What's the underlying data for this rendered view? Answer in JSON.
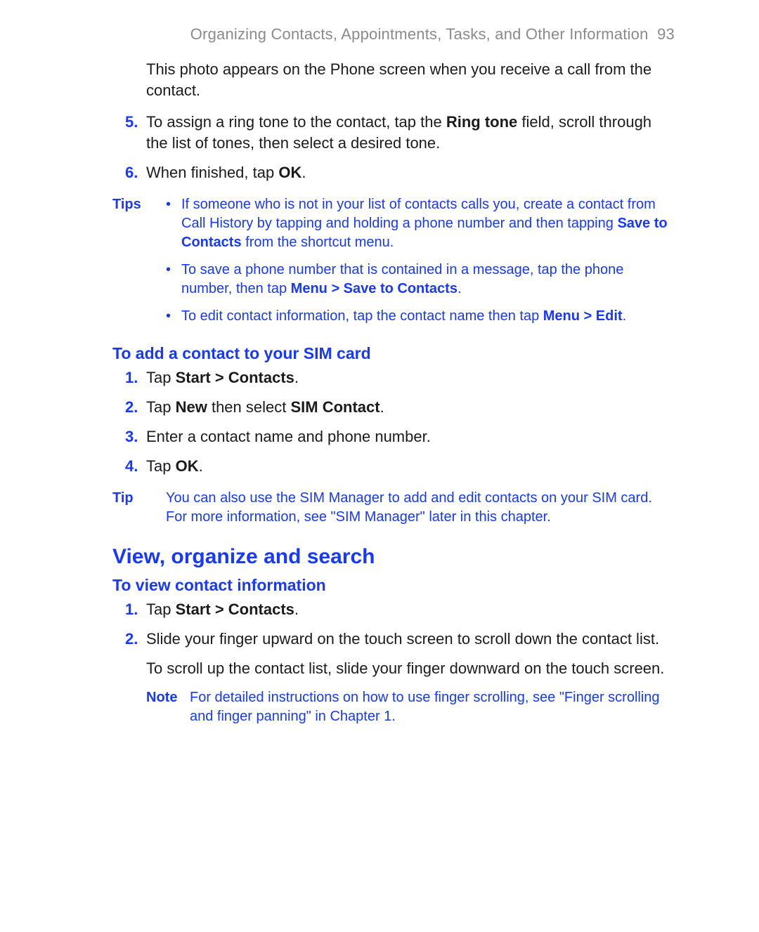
{
  "header": {
    "title": "Organizing Contacts, Appointments, Tasks, and Other Information",
    "page_number": "93"
  },
  "intro_para": "This photo appears on the Phone screen when you receive a call from the contact.",
  "steps_top": [
    {
      "num": "5.",
      "pre": "To assign a ring tone to the contact, tap the ",
      "bold1": "Ring tone",
      "post": " field, scroll through the list of tones, then select a desired tone."
    },
    {
      "num": "6.",
      "pre": "When finished, tap ",
      "bold1": "OK",
      "post": "."
    }
  ],
  "tips": {
    "label": "Tips",
    "items": [
      {
        "pre": "If someone who is not in your list of contacts calls you, create a contact from Call History by tapping and holding a phone number and then tapping ",
        "bold": "Save to Contacts",
        "post": " from the shortcut menu."
      },
      {
        "pre": "To save a phone number that is contained in a message, tap the phone number, then tap ",
        "bold": "Menu > Save to Contacts",
        "post": "."
      },
      {
        "pre": "To edit contact information, tap the contact name then tap ",
        "bold": "Menu > Edit",
        "post": "."
      }
    ]
  },
  "sim_section": {
    "heading": "To add a contact to your SIM card",
    "steps": [
      {
        "num": "1.",
        "pre": "Tap ",
        "bold1": "Start > Contacts",
        "post": "."
      },
      {
        "num": "2.",
        "pre": "Tap ",
        "bold1": "New",
        "mid": " then select ",
        "bold2": "SIM Contact",
        "post": "."
      },
      {
        "num": "3.",
        "pre": "Enter a contact name and phone number.",
        "bold1": "",
        "post": ""
      },
      {
        "num": "4.",
        "pre": "Tap ",
        "bold1": "OK",
        "post": "."
      }
    ]
  },
  "tip": {
    "label": "Tip",
    "text": "You can also use the SIM Manager to add and edit contacts on your SIM card. For more information, see \"SIM Manager\" later in this chapter."
  },
  "view_section": {
    "heading": "View, organize and search",
    "subhead": "To view contact information",
    "steps": [
      {
        "num": "1.",
        "pre": "Tap ",
        "bold1": "Start > Contacts",
        "post": "."
      },
      {
        "num": "2.",
        "pre": "Slide your finger upward on the touch screen to scroll down the contact list.",
        "bold1": "",
        "post": ""
      }
    ],
    "extra_para": "To scroll up the contact list, slide your finger downward on the touch screen.",
    "note": {
      "label": "Note",
      "text": "For detailed instructions on how to use finger scrolling, see \"Finger scrolling and finger panning\" in Chapter 1."
    }
  }
}
